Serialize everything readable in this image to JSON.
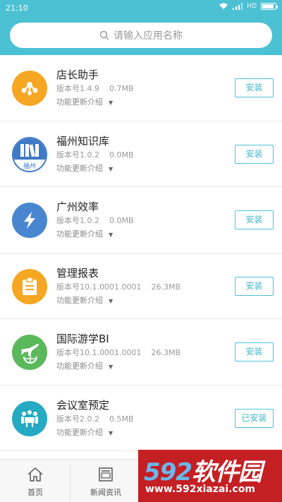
{
  "status_bar": {
    "time": "21:10",
    "network": "HD"
  },
  "search": {
    "placeholder": "请输入应用名称"
  },
  "apps": [
    {
      "name": "店长助手",
      "version": "版本号1.4.9",
      "size": "0.7MB",
      "desc": "功能更新介绍",
      "button": "安装",
      "icon": "share-nodes-icon",
      "color": "#f5a623"
    },
    {
      "name": "福州知识库",
      "version": "版本号1.0.2",
      "size": "0.0MB",
      "desc": "功能更新介绍",
      "button": "安装",
      "icon": "books-icon",
      "icon_text": "福州",
      "color": "#3f7ac6"
    },
    {
      "name": "广州效率",
      "version": "版本号1.0.2",
      "size": "0.0MB",
      "desc": "功能更新介绍",
      "button": "安装",
      "icon": "lightning-icon",
      "color": "#4a86d0"
    },
    {
      "name": "管理报表",
      "version": "版本号10.1.0001.0001",
      "size": "26.3MB",
      "desc": "功能更新介绍",
      "button": "安装",
      "icon": "clipboard-icon",
      "color": "#f5a623"
    },
    {
      "name": "国际游学BI",
      "version": "版本号10.1.0001.0001",
      "size": "26.3MB",
      "desc": "功能更新介绍",
      "button": "安装",
      "icon": "airplane-globe-icon",
      "color": "#5cb85c"
    },
    {
      "name": "会议室预定",
      "version": "版本号2.0.2",
      "size": "0.5MB",
      "desc": "功能更新介绍",
      "button": "已安装",
      "icon": "meeting-icon",
      "color": "#26a9c2"
    }
  ],
  "tabs": [
    {
      "label": "首页",
      "icon": "home-icon"
    },
    {
      "label": "新闻资讯",
      "icon": "news-icon"
    }
  ],
  "watermark": {
    "big_digits": "592",
    "big_text": "软件园",
    "url": "www.592xiazai.com"
  }
}
